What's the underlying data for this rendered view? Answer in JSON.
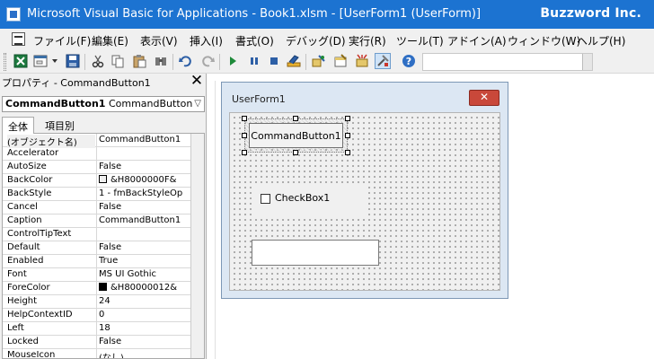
{
  "window": {
    "title": "Microsoft Visual Basic for Applications - Book1.xlsm - [UserForm1 (UserForm)]",
    "watermark": "Buzzword Inc."
  },
  "menu": {
    "items": [
      "ファイル(F)",
      "編集(E)",
      "表示(V)",
      "挿入(I)",
      "書式(O)",
      "デバッグ(D)",
      "実行(R)",
      "ツール(T)",
      "アドイン(A)",
      "ウィンドウ(W)",
      "ヘルプ(H)"
    ]
  },
  "toolbar": {
    "icons": [
      "excel-icon",
      "insert-userform-icon",
      "dropdown-arrow-icon",
      "save-icon",
      "cut-icon",
      "copy-icon",
      "paste-icon",
      "find-icon",
      "undo-icon",
      "redo-icon",
      "run-icon",
      "break-icon",
      "reset-icon",
      "design-mode-icon",
      "project-explorer-icon",
      "properties-window-icon",
      "object-browser-icon",
      "toolbox-icon",
      "help-icon"
    ]
  },
  "properties": {
    "title": "プロパティ - CommandButton1",
    "close_glyph": "✕",
    "object_name": "CommandButton1",
    "object_type": "CommandButton",
    "tabs": [
      "全体",
      "項目別"
    ],
    "rows": [
      {
        "name": "(オブジェクト名)",
        "value": "CommandButton1"
      },
      {
        "name": "Accelerator",
        "value": ""
      },
      {
        "name": "AutoSize",
        "value": "False"
      },
      {
        "name": "BackColor",
        "value": "&H8000000F&",
        "swatch": "#f0f0f0"
      },
      {
        "name": "BackStyle",
        "value": "1 - fmBackStyleOp"
      },
      {
        "name": "Cancel",
        "value": "False"
      },
      {
        "name": "Caption",
        "value": "CommandButton1"
      },
      {
        "name": "ControlTipText",
        "value": ""
      },
      {
        "name": "Default",
        "value": "False"
      },
      {
        "name": "Enabled",
        "value": "True"
      },
      {
        "name": "Font",
        "value": "MS UI Gothic"
      },
      {
        "name": "ForeColor",
        "value": "&H80000012&",
        "swatch": "#000000"
      },
      {
        "name": "Height",
        "value": "24"
      },
      {
        "name": "HelpContextID",
        "value": "0"
      },
      {
        "name": "Left",
        "value": "18"
      },
      {
        "name": "Locked",
        "value": "False"
      },
      {
        "name": "MouseIcon",
        "value": "(なし)"
      }
    ]
  },
  "userform": {
    "title": "UserForm1",
    "close_glyph": "✕",
    "command_button": "CommandButton1",
    "checkbox_label": "CheckBox1",
    "checkbox_checked": false,
    "textbox_value": ""
  }
}
